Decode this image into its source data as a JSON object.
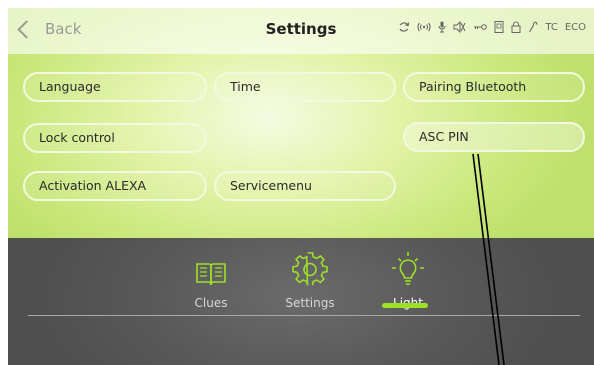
{
  "header": {
    "back_label": "Back",
    "title": "Settings",
    "status_text": {
      "tc": "TC",
      "eco": "ECO"
    },
    "status_icons": [
      "sync-icon",
      "signal-icon",
      "microphone-icon",
      "mute-icon",
      "key-icon",
      "phone-icon",
      "lock-icon",
      "wrench-icon"
    ]
  },
  "menu": {
    "language": "Language",
    "time": "Time",
    "pairing_bluetooth": "Pairing Bluetooth",
    "lock_control": "Lock control",
    "asc_pin": "ASC PIN",
    "activation_alexa": "Activation ALEXA",
    "servicemenu": "Servicemenu"
  },
  "tabs": {
    "clues": "Clues",
    "settings": "Settings",
    "light": "Light",
    "active": "Light"
  },
  "colors": {
    "accent": "#9ee028",
    "top_background": "#d8ef96",
    "bottom_background": "#5a5a5a"
  }
}
